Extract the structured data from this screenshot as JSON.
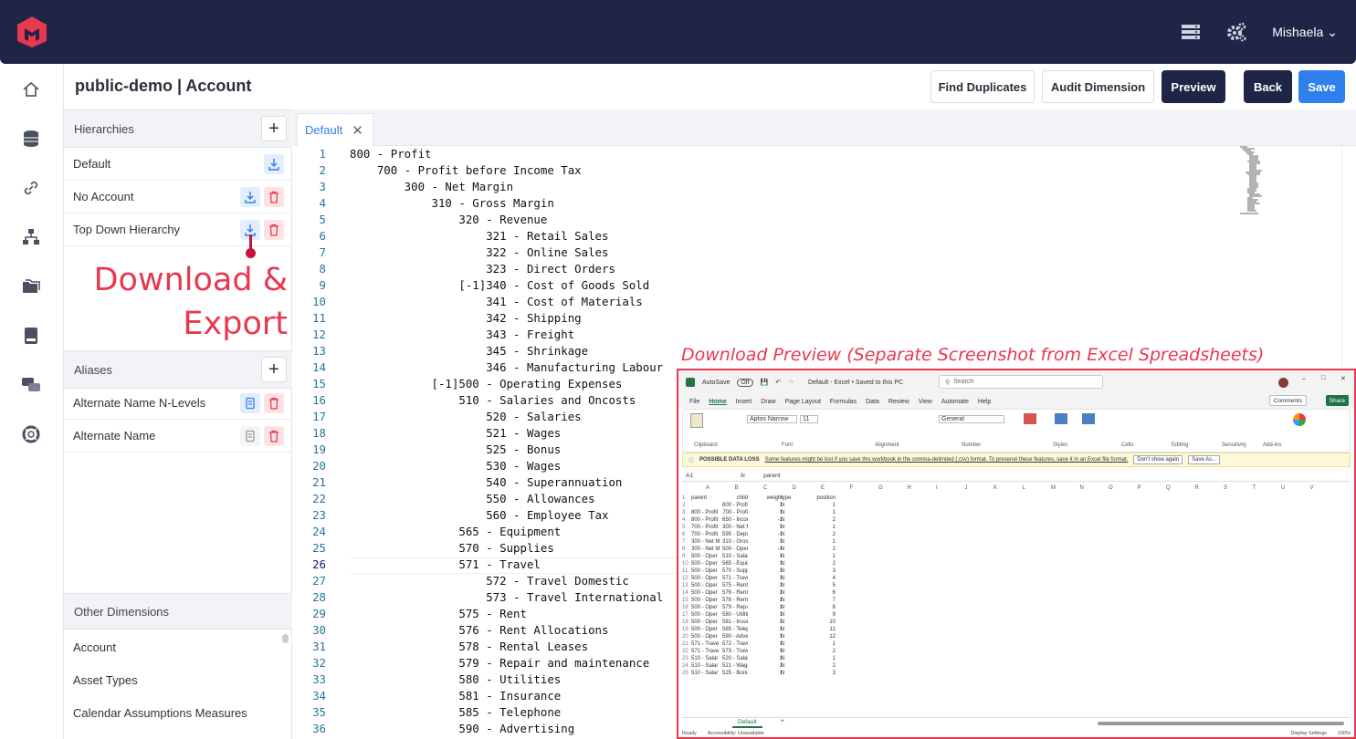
{
  "topbar": {
    "user_name": "Mishaela"
  },
  "header": {
    "title": "public-demo | Account",
    "buttons": {
      "find_duplicates": "Find Duplicates",
      "audit_dimension": "Audit Dimension",
      "preview": "Preview",
      "back": "Back",
      "save": "Save"
    }
  },
  "hierarchies": {
    "label": "Hierarchies",
    "items": [
      {
        "label": "Default"
      },
      {
        "label": "No Account"
      },
      {
        "label": "Top Down Hierarchy"
      }
    ]
  },
  "annotation": {
    "line1": "Download &",
    "line2": "Export",
    "preview_caption": "Download Preview (Separate Screenshot from Excel Spreadsheets)"
  },
  "aliases": {
    "label": "Aliases",
    "items": [
      {
        "label": "Alternate Name N-Levels"
      },
      {
        "label": "Alternate Name"
      }
    ]
  },
  "other_dimensions": {
    "label": "Other Dimensions",
    "items": [
      {
        "label": "Account"
      },
      {
        "label": "Asset Types"
      },
      {
        "label": "Calendar Assumptions Measures"
      }
    ]
  },
  "editor": {
    "tab_label": "Default",
    "current_line": 26,
    "lines": [
      "800 - Profit",
      "    700 - Profit before Income Tax",
      "        300 - Net Margin",
      "            310 - Gross Margin",
      "                320 - Revenue",
      "                    321 - Retail Sales",
      "                    322 - Online Sales",
      "                    323 - Direct Orders",
      "                [-1]340 - Cost of Goods Sold",
      "                    341 - Cost of Materials",
      "                    342 - Shipping",
      "                    343 - Freight",
      "                    345 - Shrinkage",
      "                    346 - Manufacturing Labour",
      "            [-1]500 - Operating Expenses",
      "                510 - Salaries and Oncosts",
      "                    520 - Salaries",
      "                    521 - Wages",
      "                    525 - Bonus",
      "                    530 - Wages",
      "                    540 - Superannuation",
      "                    550 - Allowances",
      "                    560 - Employee Tax",
      "                565 - Equipment",
      "                570 - Supplies",
      "                571 - Travel",
      "                    572 - Travel Domestic",
      "                    573 - Travel International",
      "                575 - Rent",
      "                576 - Rent Allocations",
      "                578 - Rental Leases",
      "                579 - Repair and maintenance",
      "                580 - Utilities",
      "                581 - Insurance",
      "                585 - Telephone",
      "                590 - Advertising"
    ]
  },
  "excel": {
    "autosave": "AutoSave",
    "autosave_state": "Off",
    "file_title": "Default - Excel • Saved to this PC",
    "search_placeholder": "Search",
    "menu": [
      "File",
      "Home",
      "Insert",
      "Draw",
      "Page Layout",
      "Formulas",
      "Data",
      "Review",
      "View",
      "Automate",
      "Help"
    ],
    "comments": "Comments",
    "share": "Share",
    "ribbon_groups": [
      "Clipboard",
      "Font",
      "Alignment",
      "Number",
      "Styles",
      "Cells",
      "Editing",
      "Sensitivity",
      "Add-ins"
    ],
    "font_name": "Aptos Narrow",
    "font_size": "11",
    "number_format": "General",
    "warning_title": "POSSIBLE DATA LOSS",
    "warning_text": "Some features might be lost if you save this workbook in the comma-delimited (.csv) format. To preserve these features, save it in an Excel file format.",
    "warning_btn1": "Don't show again",
    "warning_btn2": "Save As...",
    "cell_ref": "A1",
    "formula_value": "parent",
    "columns": [
      "A",
      "B",
      "C",
      "D",
      "E",
      "F",
      "G",
      "H",
      "I",
      "J",
      "K",
      "L",
      "M",
      "N",
      "O",
      "P",
      "Q",
      "R",
      "S",
      "T",
      "U",
      "V"
    ],
    "headers": [
      "parent",
      "child",
      "weight",
      "type",
      "position"
    ],
    "rows": [
      [
        "",
        "800 - Profit",
        "1",
        "N",
        "1"
      ],
      [
        "800 - Profit",
        "700 - Profi",
        "1",
        "N",
        "1"
      ],
      [
        "800 - Profit",
        "650 - Incom",
        "-1",
        "N",
        "2"
      ],
      [
        "700 - Profit",
        "300 - Net M",
        "1",
        "N",
        "1"
      ],
      [
        "700 - Profit",
        "595 - Depr",
        "-1",
        "N",
        "2"
      ],
      [
        "300 - Net M",
        "310 - Gros",
        "1",
        "N",
        "1"
      ],
      [
        "300 - Net M",
        "500 - Oper",
        "-1",
        "N",
        "2"
      ],
      [
        "500 - Oper",
        "510 - Salar",
        "1",
        "N",
        "1"
      ],
      [
        "500 - Oper",
        "565 - Equip",
        "1",
        "N",
        "2"
      ],
      [
        "500 - Oper",
        "570 - Supp",
        "1",
        "N",
        "3"
      ],
      [
        "500 - Oper",
        "571 - Trave",
        "1",
        "N",
        "4"
      ],
      [
        "500 - Oper",
        "575 - Rent",
        "1",
        "N",
        "5"
      ],
      [
        "500 - Oper",
        "576 - Rent",
        "1",
        "N",
        "6"
      ],
      [
        "500 - Oper",
        "578 - Rent",
        "1",
        "N",
        "7"
      ],
      [
        "500 - Oper",
        "579 - Repai",
        "1",
        "N",
        "8"
      ],
      [
        "500 - Oper",
        "580 - Utiliti",
        "1",
        "N",
        "9"
      ],
      [
        "500 - Oper",
        "581 - Insur",
        "1",
        "N",
        "10"
      ],
      [
        "500 - Oper",
        "585 - Telep",
        "1",
        "N",
        "11"
      ],
      [
        "500 - Oper",
        "590 - Adve",
        "1",
        "N",
        "12"
      ],
      [
        "571 - Trave",
        "572 - Trave",
        "1",
        "N",
        "1"
      ],
      [
        "571 - Trave",
        "573 - Trave",
        "1",
        "N",
        "2"
      ],
      [
        "510 - Salar",
        "520 - Salar",
        "1",
        "N",
        "1"
      ],
      [
        "510 - Salar",
        "521 - Wage",
        "1",
        "N",
        "2"
      ],
      [
        "510 - Salar",
        "525 - Bonu",
        "1",
        "N",
        "3"
      ]
    ],
    "sheet_tab": "Default",
    "status_ready": "Ready",
    "status_access": "Accessibility: Unavailable",
    "status_display": "Display Settings",
    "zoom": "100%"
  }
}
